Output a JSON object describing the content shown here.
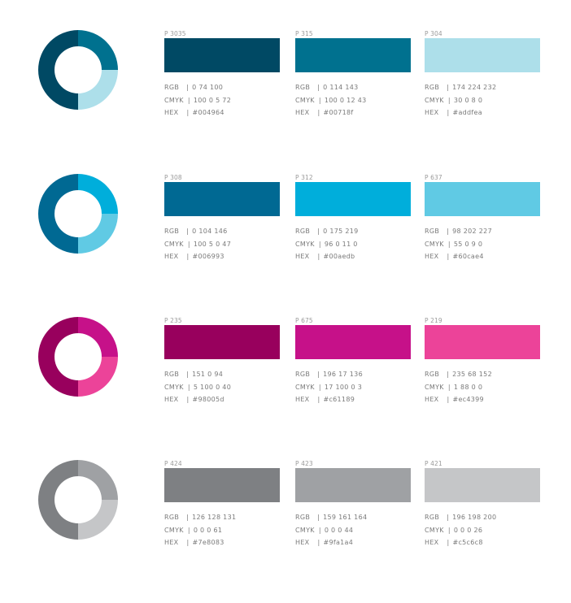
{
  "groups": [
    {
      "donut": {
        "dark": "#004964",
        "mid": "#00718f",
        "light": "#addfea"
      },
      "swatches": [
        {
          "pantone": "P 3035",
          "color": "#004964",
          "rgb": "0 74 100",
          "cmyk": "100 0 5 72",
          "hex": "#004964"
        },
        {
          "pantone": "P 315",
          "color": "#00718f",
          "rgb": "0 114 143",
          "cmyk": "100 0 12 43",
          "hex": "#00718f"
        },
        {
          "pantone": "P 304",
          "color": "#addfea",
          "rgb": "174 224 232",
          "cmyk": "30 0 8 0",
          "hex": "#addfea"
        }
      ]
    },
    {
      "donut": {
        "dark": "#006993",
        "mid": "#00aedb",
        "light": "#60cae4"
      },
      "swatches": [
        {
          "pantone": "P 308",
          "color": "#006993",
          "rgb": "0 104 146",
          "cmyk": "100 5 0 47",
          "hex": "#006993"
        },
        {
          "pantone": "P 312",
          "color": "#00aedb",
          "rgb": "0 175 219",
          "cmyk": "96 0 11 0",
          "hex": "#00aedb"
        },
        {
          "pantone": "P 637",
          "color": "#60cae4",
          "rgb": "98 202 227",
          "cmyk": "55 0 9 0",
          "hex": "#60cae4"
        }
      ]
    },
    {
      "donut": {
        "dark": "#98005d",
        "mid": "#c61189",
        "light": "#ec4399"
      },
      "swatches": [
        {
          "pantone": "P 235",
          "color": "#98005d",
          "rgb": "151 0 94",
          "cmyk": "5 100 0 40",
          "hex": "#98005d"
        },
        {
          "pantone": "P 675",
          "color": "#c61189",
          "rgb": "196 17 136",
          "cmyk": "17 100 0 3",
          "hex": "#c61189"
        },
        {
          "pantone": "P 219",
          "color": "#ec4399",
          "rgb": "235 68 152",
          "cmyk": "1 88 0 0",
          "hex": "#ec4399"
        }
      ]
    },
    {
      "donut": {
        "dark": "#7e8083",
        "mid": "#9fa1a4",
        "light": "#c5c6c8"
      },
      "swatches": [
        {
          "pantone": "P 424",
          "color": "#7e8083",
          "rgb": "126 128 131",
          "cmyk": "0 0 0 61",
          "hex": "#7e8083"
        },
        {
          "pantone": "P 423",
          "color": "#9fa1a4",
          "rgb": "159 161 164",
          "cmyk": "0 0 0 44",
          "hex": "#9fa1a4"
        },
        {
          "pantone": "P 421",
          "color": "#c5c6c8",
          "rgb": "196 198 200",
          "cmyk": "0 0 0 26",
          "hex": "#c5c6c8"
        }
      ]
    }
  ],
  "labels": {
    "rgb": "RGB",
    "cmyk": "CMYK",
    "hex": "HEX",
    "sep": "|"
  }
}
